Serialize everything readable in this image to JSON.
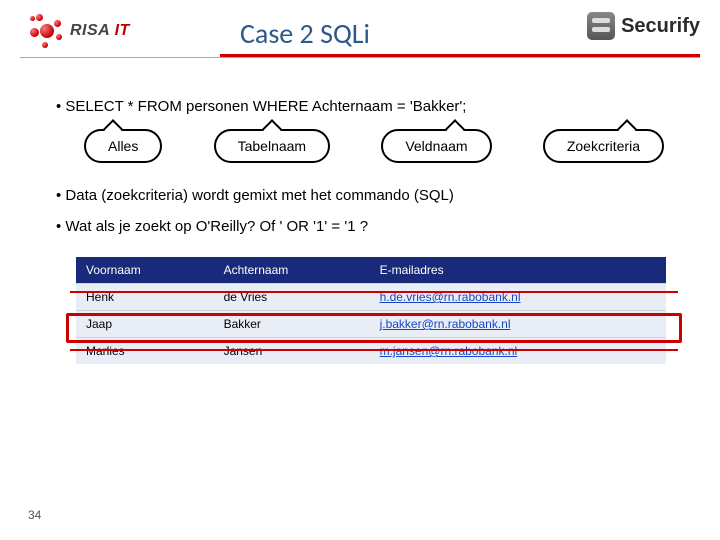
{
  "header": {
    "logo_left_text": "RISA",
    "logo_left_suffix": "IT",
    "title": "Case 2 SQLi",
    "logo_right_text": "Securify"
  },
  "bullets": {
    "sql": "SELECT * FROM personen WHERE Achternaam = 'Bakker';",
    "mix": "Data (zoekcriteria) wordt gemixt met het commando (SQL)",
    "what_if": "Wat als je zoekt op O'Reilly? Of ' OR '1' = '1 ?"
  },
  "bubbles": {
    "alles": "Alles",
    "tabelnaam": "Tabelnaam",
    "veldnaam": "Veldnaam",
    "zoekcriteria": "Zoekcriteria"
  },
  "table": {
    "headers": {
      "voornaam": "Voornaam",
      "achternaam": "Achternaam",
      "email": "E-mailadres"
    },
    "rows": [
      {
        "voornaam": "Henk",
        "achternaam": "de Vries",
        "email": "h.de.vries@rn.rabobank.nl"
      },
      {
        "voornaam": "Jaap",
        "achternaam": "Bakker",
        "email": "j.bakker@rn.rabobank.nl"
      },
      {
        "voornaam": "Marlies",
        "achternaam": "Jansen",
        "email": "m.jansen@rn.rabobank.nl"
      }
    ]
  },
  "page_number": "34"
}
